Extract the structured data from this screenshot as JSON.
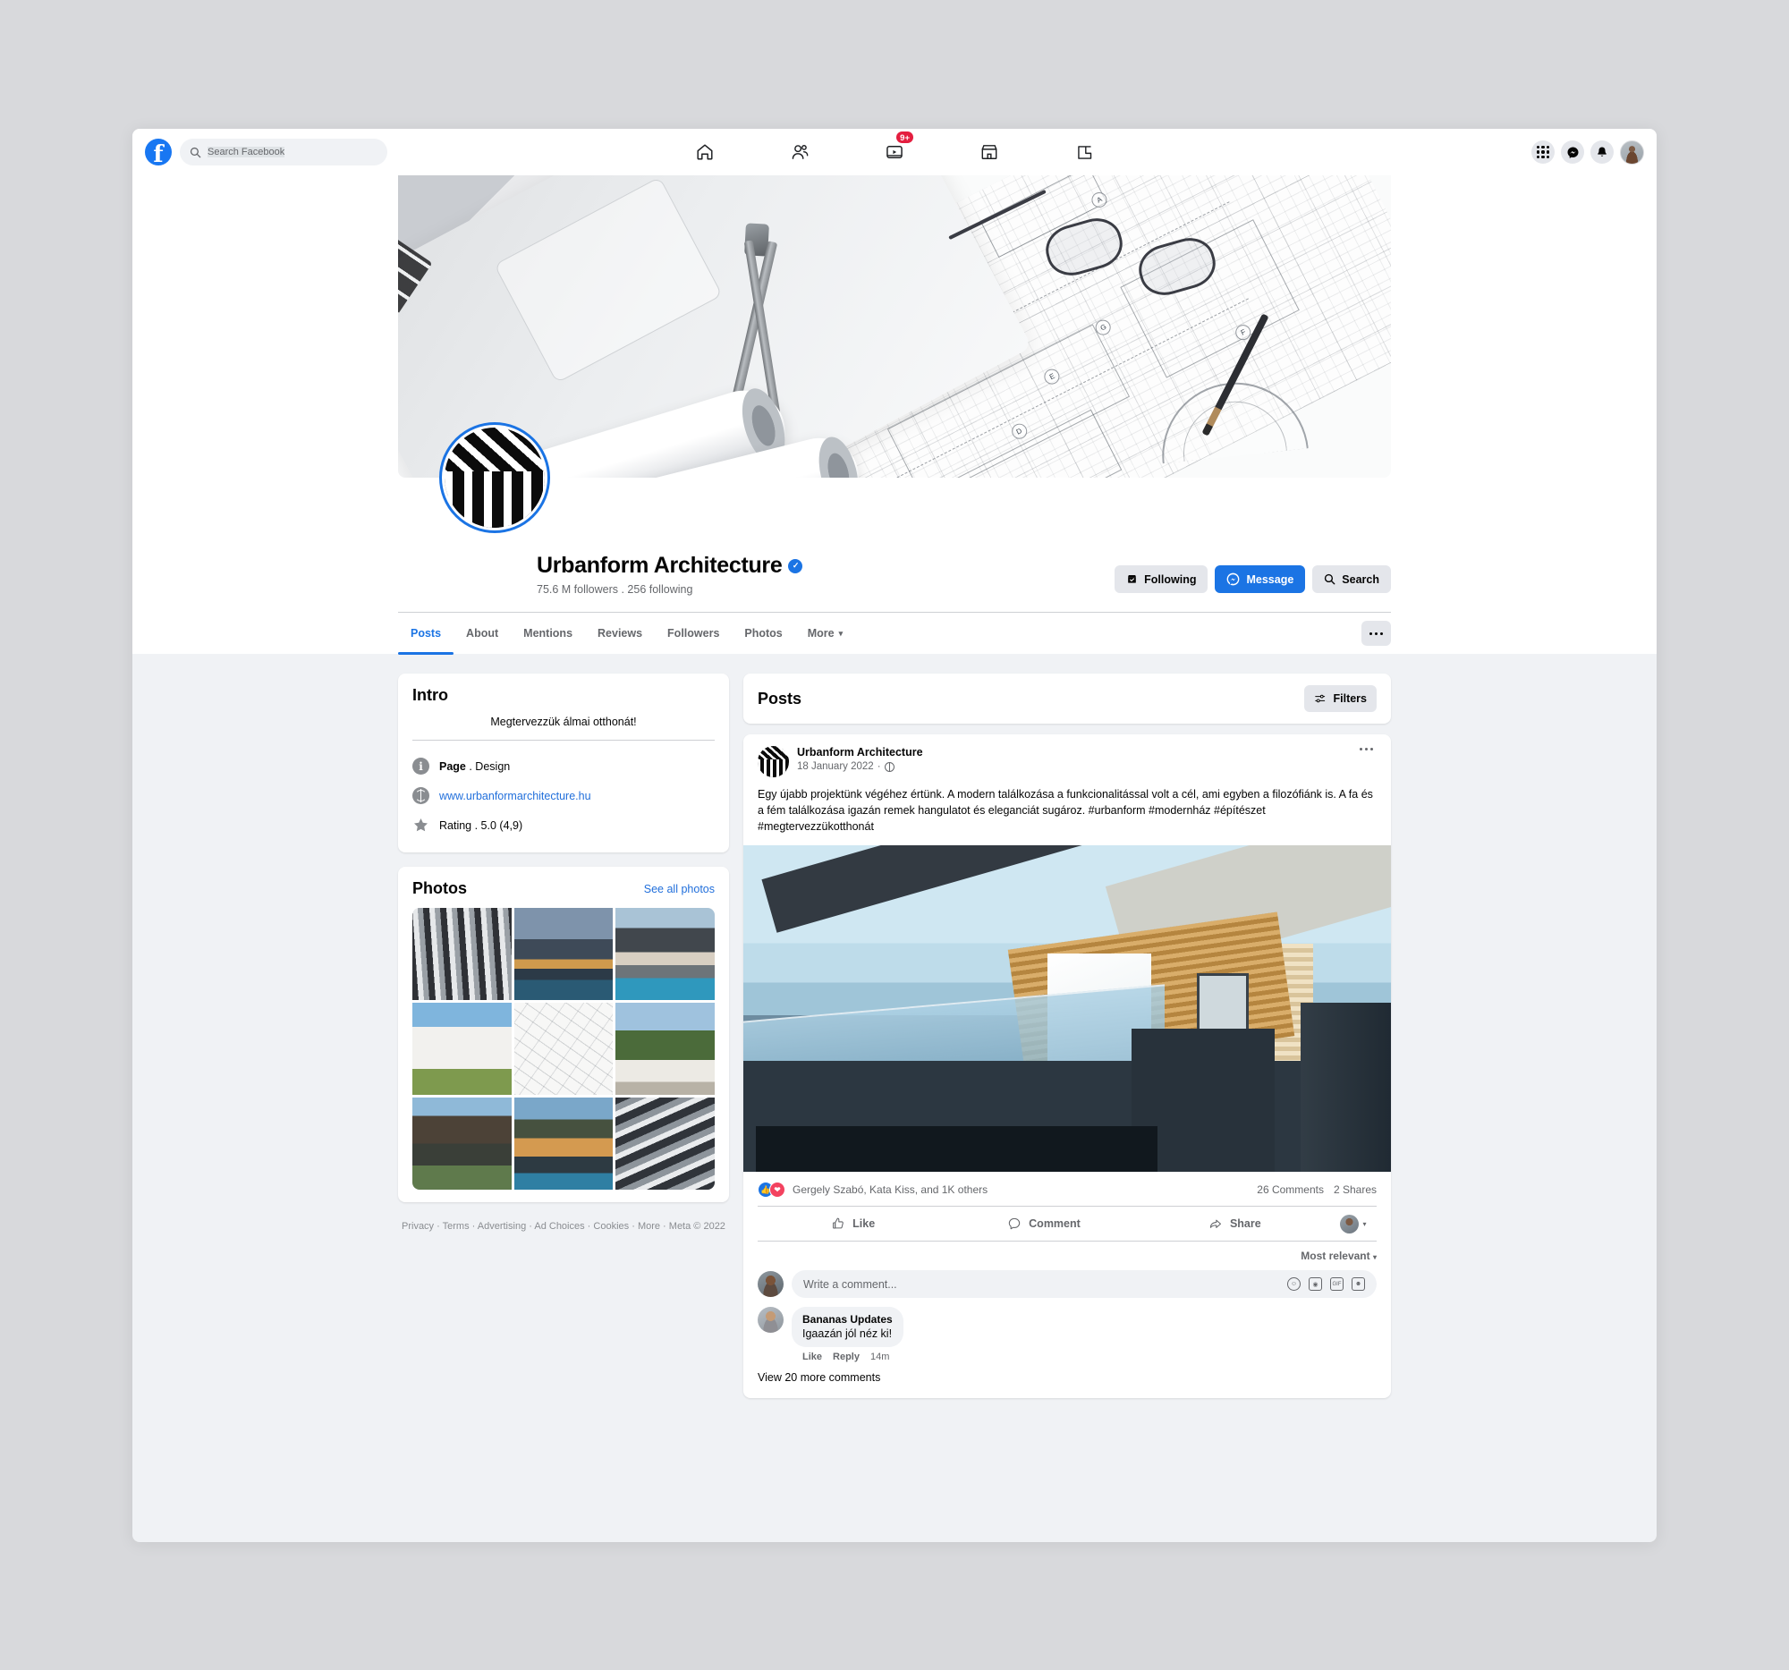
{
  "topbar": {
    "logo": "facebook-logo",
    "search_placeholder": "Search Facebook",
    "nav": [
      {
        "name": "home-icon",
        "badge": ""
      },
      {
        "name": "friends-icon",
        "badge": ""
      },
      {
        "name": "watch-icon",
        "badge": "9+"
      },
      {
        "name": "marketplace-icon",
        "badge": ""
      },
      {
        "name": "groups-icon",
        "badge": ""
      }
    ],
    "right": [
      {
        "name": "menu-grid-icon"
      },
      {
        "name": "messenger-icon"
      },
      {
        "name": "notifications-icon"
      },
      {
        "name": "account-avatar"
      }
    ]
  },
  "profile": {
    "name": "Urbanform Architecture",
    "verified": true,
    "stats": "75.6 M followers . 256 following",
    "actions": {
      "following": "Following",
      "message": "Message",
      "search": "Search"
    }
  },
  "tabs": [
    {
      "label": "Posts",
      "active": true
    },
    {
      "label": "About",
      "active": false
    },
    {
      "label": "Mentions",
      "active": false
    },
    {
      "label": "Reviews",
      "active": false
    },
    {
      "label": "Followers",
      "active": false
    },
    {
      "label": "Photos",
      "active": false
    },
    {
      "label": "More",
      "active": false,
      "caret": "▾"
    }
  ],
  "intro": {
    "title": "Intro",
    "tagline": "Megtervezzük álmai otthonát!",
    "rows": [
      {
        "icon": "info-icon",
        "bold": "Page",
        "rest": " . Design"
      },
      {
        "icon": "globe-icon",
        "link": "www.urbanformarchitecture.hu"
      },
      {
        "icon": "star-icon",
        "text": "Rating . 5.0 (4,9)"
      }
    ]
  },
  "photos": {
    "title": "Photos",
    "see_all": "See all photos",
    "items": [
      "facade-louvers-bw",
      "modern-house-dusk-pool",
      "dark-house-pool",
      "white-minimal-house",
      "blueprint-drafting-tools",
      "white-house-tree",
      "cantilever-house-lake",
      "glass-house-night-pool",
      "balconies-bw"
    ]
  },
  "footer": {
    "links": [
      "Privacy",
      "Terms",
      "Advertising",
      "Ad Choices",
      "Cookies",
      "More"
    ],
    "copyright": "Meta © 2022",
    "separator": " · "
  },
  "posts": {
    "title": "Posts",
    "filters_label": "Filters",
    "post": {
      "author": "Urbanform Architecture",
      "date": "18 January 2022",
      "privacy_icon": "globe-icon",
      "more_icon": "ellipsis-icon",
      "text": "Egy újabb projektünk végéhez értünk. A modern találkozása a funkcionalitással volt a cél, ami egyben a filozófiánk is. A fa és a fém találkozása igazán remek hangulatot és eleganciát sugároz. #urbanform #modernház #építészet #megtervezzükotthonát",
      "image": "modern-house-balcony-photo",
      "reactions": {
        "icons": [
          "like-reaction",
          "love-reaction"
        ],
        "names": "Gergely Szabó, Kata Kiss, and 1K others",
        "comments": "26 Comments",
        "shares": "2 Shares"
      },
      "actions": [
        {
          "label": "Like",
          "icon": "thumbs-up-icon"
        },
        {
          "label": "Comment",
          "icon": "comment-bubble-icon"
        },
        {
          "label": "Share",
          "icon": "share-arrow-icon"
        }
      ],
      "sort": "Most relevant",
      "sort_caret": "▾",
      "comment_placeholder": "Write a comment...",
      "comment_icons": [
        "emoji-icon",
        "camera-icon",
        "gif-icon",
        "sticker-icon"
      ],
      "comments_list": [
        {
          "author": "Bananas Updates",
          "text": "Igaazán jól néz ki!",
          "like": "Like",
          "reply": "Reply",
          "time": "14m"
        }
      ],
      "view_more": "View 20 more comments"
    }
  },
  "colors": {
    "brand": "#1877f2",
    "accent": "#1b74e4",
    "link": "#216fdb",
    "badge": "#e41e3f",
    "page_bg": "#f0f2f5"
  }
}
